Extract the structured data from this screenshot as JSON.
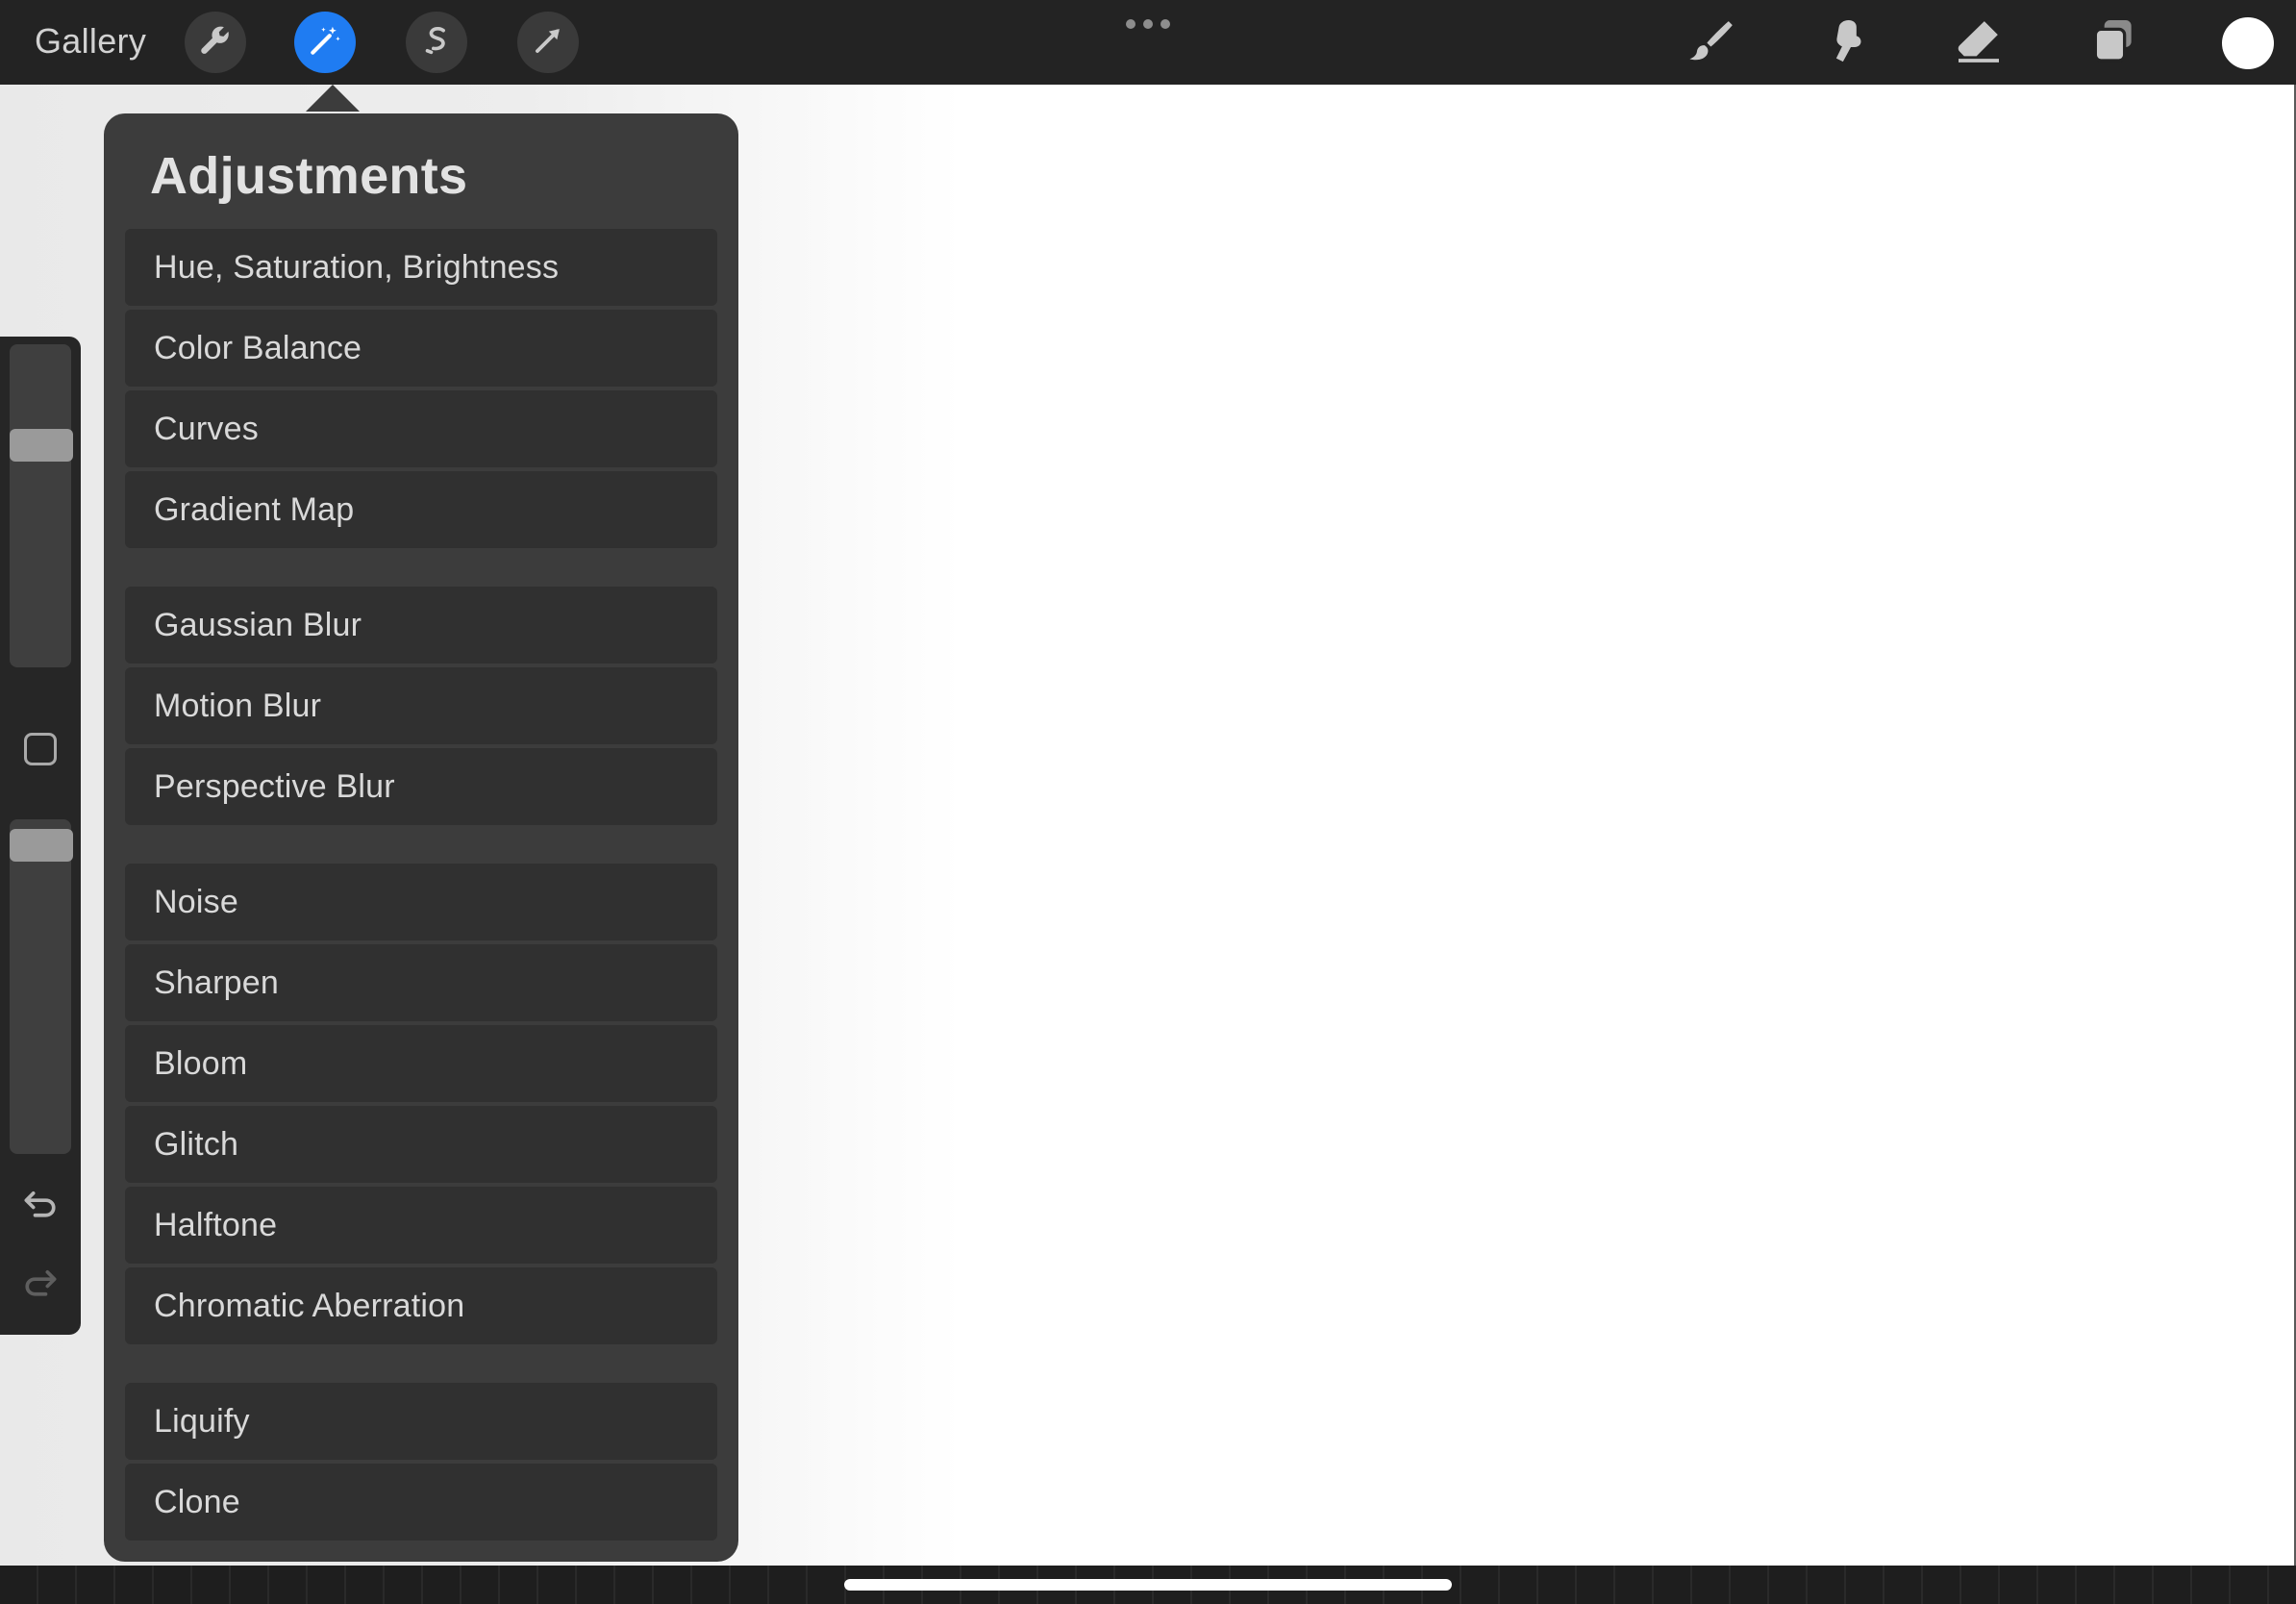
{
  "toolbar": {
    "gallery_label": "Gallery",
    "accent_color": "#1f7cf2",
    "left_tools": [
      {
        "name": "actions",
        "icon": "wrench-icon",
        "active": false
      },
      {
        "name": "adjustments",
        "icon": "magic-wand-icon",
        "active": true
      },
      {
        "name": "selection",
        "icon": "selection-s-icon",
        "active": false
      },
      {
        "name": "transform",
        "icon": "arrow-cursor-icon",
        "active": false
      }
    ],
    "more_icon": "more-dots-icon",
    "right_tools": [
      {
        "name": "brush",
        "icon": "brush-icon"
      },
      {
        "name": "smudge",
        "icon": "smudge-icon"
      },
      {
        "name": "eraser",
        "icon": "eraser-icon"
      },
      {
        "name": "layers",
        "icon": "layers-icon"
      }
    ],
    "current_color": "#ffffff"
  },
  "sidebar": {
    "brush_size_icon": "slider-icon",
    "modify_icon": "square-icon",
    "undo_icon": "undo-icon",
    "redo_icon": "redo-icon"
  },
  "adjustments": {
    "title": "Adjustments",
    "groups": [
      [
        "Hue, Saturation, Brightness",
        "Color Balance",
        "Curves",
        "Gradient Map"
      ],
      [
        "Gaussian Blur",
        "Motion Blur",
        "Perspective Blur"
      ],
      [
        "Noise",
        "Sharpen",
        "Bloom",
        "Glitch",
        "Halftone",
        "Chromatic Aberration"
      ],
      [
        "Liquify",
        "Clone"
      ]
    ]
  }
}
